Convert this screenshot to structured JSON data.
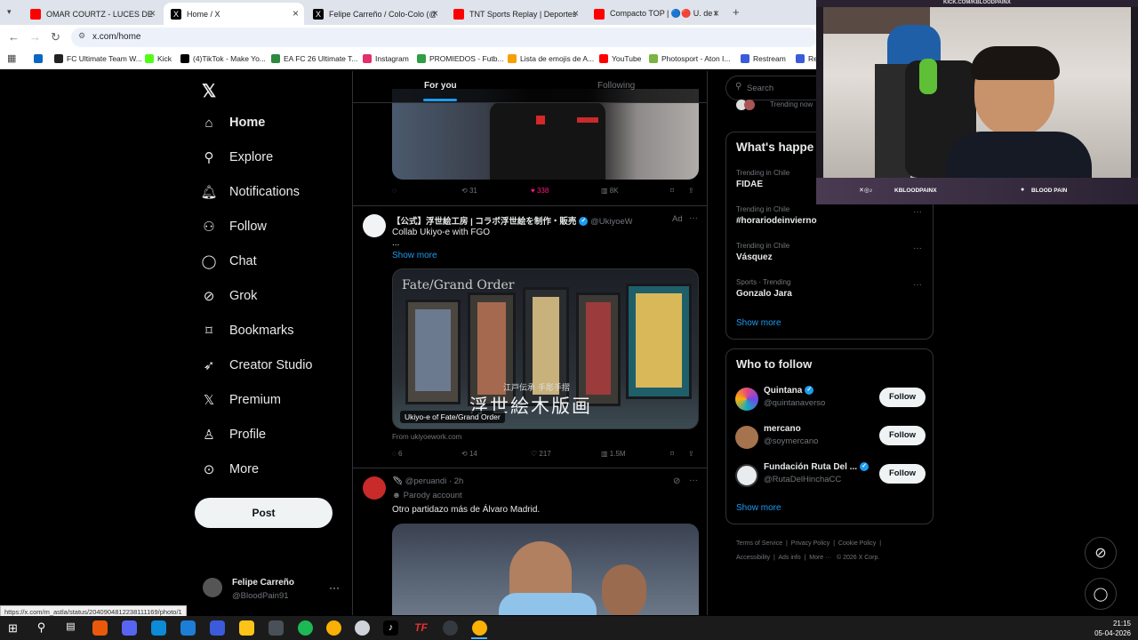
{
  "browser": {
    "tabs": [
      {
        "title": "OMAR COURTZ - LUCES DE CO",
        "color": "#ff0000"
      },
      {
        "title": "Home / X",
        "color": "#000000",
        "active": true
      },
      {
        "title": "Felipe Carreño / Colo-Colo (@s",
        "color": "#000000"
      },
      {
        "title": "TNT Sports Replay | Deportes C",
        "color": "#ff0000"
      },
      {
        "title": "Compacto TOP | 🔵🔴 U. de C",
        "color": "#ff0000"
      }
    ],
    "new_tab": "+",
    "url": "x.com/home",
    "bookmarks": [
      {
        "label": "FC Ultimate Team W...",
        "color": "#222222"
      },
      {
        "label": "Kick",
        "color": "#53fc18"
      },
      {
        "label": "(4)TikTok - Make Yo...",
        "color": "#000000"
      },
      {
        "label": "EA FC 26 Ultimate T...",
        "color": "#2b8a3e"
      },
      {
        "label": "Instagram",
        "color": "#e1306c"
      },
      {
        "label": "PROMIEDOS - Futb...",
        "color": "#2f9e44"
      },
      {
        "label": "Lista de emojis de A...",
        "color": "#f59f00"
      },
      {
        "label": "YouTube",
        "color": "#ff0000"
      },
      {
        "label": "Photosport - Aton I...",
        "color": "#7cb342"
      },
      {
        "label": "Restream",
        "color": "#3b5bdb"
      },
      {
        "label": "Res",
        "color": "#3b5bdb"
      }
    ]
  },
  "x": {
    "nav": [
      {
        "label": "Home",
        "icon": "home-icon",
        "glyph": "⌂"
      },
      {
        "label": "Explore",
        "icon": "search-icon",
        "glyph": "⌕"
      },
      {
        "label": "Notifications",
        "icon": "bell-icon",
        "glyph": "🔔"
      },
      {
        "label": "Follow",
        "icon": "add-person-icon",
        "glyph": "👤"
      },
      {
        "label": "Chat",
        "icon": "chat-icon",
        "glyph": "💬"
      },
      {
        "label": "Grok",
        "icon": "grok-icon",
        "glyph": "◩"
      },
      {
        "label": "Bookmarks",
        "icon": "bookmark-icon",
        "glyph": "🔖"
      },
      {
        "label": "Creator Studio",
        "icon": "rocket-icon",
        "glyph": "🚀"
      },
      {
        "label": "Premium",
        "icon": "x-logo-icon",
        "glyph": "X"
      },
      {
        "label": "Profile",
        "icon": "person-icon",
        "glyph": "👤"
      },
      {
        "label": "More",
        "icon": "more-circle-icon",
        "glyph": "⋯"
      }
    ],
    "post_button": "Post",
    "account": {
      "name": "Felipe Carreño",
      "handle": "@BloodPain91"
    },
    "feed_tabs": {
      "for_you": "For you",
      "following": "Following"
    },
    "tweet1": {
      "replies": "",
      "retweets": "31",
      "likes": "338",
      "views": "8K"
    },
    "tweet2": {
      "name": "【公式】浮世絵工房 | コラボ浮世絵を制作・販売",
      "handle": "@UkiyoeWork",
      "ad": "Ad",
      "text": "Collab Ukiyo-e with FGO",
      "ellipsis": "...",
      "show_more": "Show more",
      "image_caption": "Ukiyo-e of Fate/Grand Order",
      "image_banner": "浮世絵木版画",
      "image_sub": "江戸伝承 手彫手摺",
      "from": "From ukiyoework.com",
      "replies": "6",
      "retweets": "14",
      "likes": "217",
      "views": "1.5M"
    },
    "tweet3": {
      "handle": "@peruandi",
      "time": "· 2h",
      "label": "Parody account",
      "text": "Otro partidazo más de Álvaro Madrid."
    },
    "search_placeholder": "Search",
    "trending_now": "Trending now",
    "whats_happening": "What's happe",
    "trends": [
      {
        "context": "Trending in Chile",
        "name": "FIDAE"
      },
      {
        "context": "Trending in Chile",
        "name": "#horariodeinvierno"
      },
      {
        "context": "Trending in Chile",
        "name": "Vásquez"
      },
      {
        "context": "Sports · Trending",
        "name": "Gonzalo Jara"
      }
    ],
    "trends_show_more": "Show more",
    "who_to_follow": "Who to follow",
    "suggestions": [
      {
        "name": "Quintana",
        "handle": "@quintanaverso",
        "verified": true,
        "color": "#7048e8"
      },
      {
        "name": "mercano",
        "handle": "@soymercano",
        "verified": false,
        "color": "#a5734d"
      },
      {
        "name": "Fundación Ruta Del ...",
        "handle": "@RutaDelHinchaCC",
        "verified": true,
        "color": "#e9ecef"
      }
    ],
    "follow_label": "Follow",
    "wtf_show_more": "Show more",
    "footer": {
      "terms": "Terms of Service",
      "privacy": "Privacy Policy",
      "cookie": "Cookie Policy",
      "accessibility": "Accessibility",
      "ads": "Ads info",
      "more": "More ···",
      "copyright": "© 2026 X Corp."
    }
  },
  "overlay": {
    "kick_url": "KICK.COM/KBLOODPAINX",
    "social_handle": "KBLOODPAINX",
    "channel_name": "BLOOD PAIN"
  },
  "status_url": "https://x.com/m_astla/status/2040904812238111169/photo/1",
  "clock": {
    "time": "21:15",
    "date": "05-04-2026"
  }
}
